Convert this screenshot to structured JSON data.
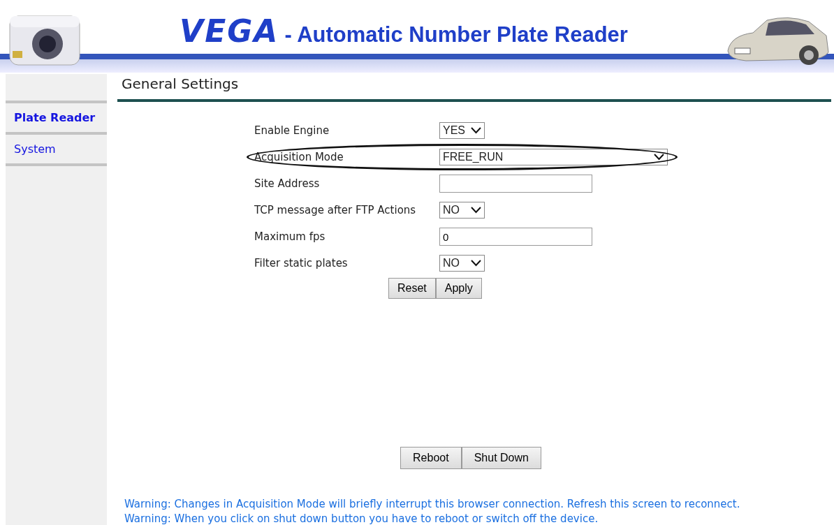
{
  "header": {
    "logo": "VEGA",
    "title": "- Automatic Number Plate Reader"
  },
  "sidebar": {
    "items": [
      {
        "label": "Plate Reader",
        "selected": true
      },
      {
        "label": "System",
        "selected": false
      }
    ]
  },
  "page_title": "General Settings",
  "fields": [
    {
      "kind": "select",
      "label": "Enable Engine",
      "value": "YES",
      "highlighted": false
    },
    {
      "kind": "select",
      "label": "Acquisition Mode",
      "value": "FREE_RUN",
      "highlighted": true
    },
    {
      "kind": "input",
      "label": "Site Address",
      "highlighted": false
    },
    {
      "kind": "select",
      "label": "TCP message after FTP Actions",
      "value": "NO",
      "highlighted": false
    },
    {
      "kind": "input",
      "label": "Maximum fps",
      "value": "0",
      "highlighted": false
    },
    {
      "kind": "select",
      "label": "Filter static plates",
      "value": "NO",
      "highlighted": false
    }
  ],
  "form_buttons": [
    "Reset",
    "Apply"
  ],
  "device_buttons": [
    "Reboot",
    "Shut Down"
  ],
  "warnings": [
    "Warning: Changes in Acquisition Mode will briefly interrupt this browser connection. Refresh this screen to reconnect.",
    "Warning: When you click on shut down button you have to reboot or switch off the device."
  ]
}
